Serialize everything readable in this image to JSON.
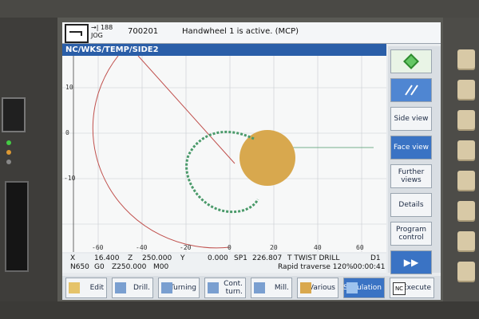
{
  "header": {
    "mode_top": "188",
    "mode_bottom": "JOG",
    "program_number": "700201",
    "message": "Handwheel 1 is active. (MCP)"
  },
  "path": "NC/WKS/TEMP/SIDE2",
  "plot": {
    "x_ticks": [
      "-60",
      "-40",
      "-20",
      "0",
      "20",
      "40",
      "60"
    ],
    "y_ticks": [
      "10",
      "0",
      "-10"
    ]
  },
  "status": {
    "x_label": "X",
    "x_value": "16.400",
    "z_label": "Z",
    "z_value": "250.000",
    "y_label": "Y",
    "y_value": "0.000",
    "sp": "SP1",
    "sp_value": "226.807",
    "tool": "T TWIST DRILL",
    "d": "D1",
    "block": "N650",
    "g": "G0",
    "z2": "Z250.000",
    "m": "M00",
    "mode_text": "Rapid traverse 120%",
    "time": "00:00:41"
  },
  "vertical_softkeys": [
    {
      "label": "",
      "icon": "cycle-start-icon"
    },
    {
      "label": "",
      "icon": "parallel-lines-icon"
    },
    {
      "label": "Side view"
    },
    {
      "label": "Face view"
    },
    {
      "label": "Further views"
    },
    {
      "label": "Details"
    },
    {
      "label": "Program control"
    },
    {
      "label": "▶▶"
    }
  ],
  "horizontal_softkeys": [
    {
      "label": "Edit",
      "icon": "edit-icon"
    },
    {
      "label": "Drill.",
      "icon": "drill-icon"
    },
    {
      "label": "Turning",
      "icon": "turning-icon"
    },
    {
      "label": "Cont. turn.",
      "icon": "contour-turn-icon"
    },
    {
      "label": "Mill.",
      "icon": "mill-icon"
    },
    {
      "label": "Various",
      "icon": "various-icon"
    },
    {
      "label": "Simulation",
      "icon": "simulation-icon"
    },
    {
      "label": "Execute",
      "icon": "nc-execute-icon"
    }
  ],
  "colors": {
    "accent_blue": "#2a5ea8",
    "active_softkey": "#3a73c4",
    "workpiece": "#d8a84e",
    "toolpath_red": "#c0504d",
    "engraving_green": "#4a9a6a"
  }
}
